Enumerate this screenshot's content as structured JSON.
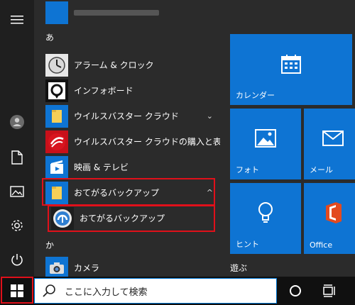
{
  "app_list": {
    "top_item_blurred": "",
    "groups": [
      {
        "letter": "あ",
        "items": [
          {
            "label": "アラーム & クロック",
            "icon": "alarm-clock-icon"
          },
          {
            "label": "インフォボード",
            "icon": "infoboard-icon"
          },
          {
            "label": "ウイルスバスター クラウド",
            "icon": "folder-icon",
            "expandable": true,
            "chevron": "⌄"
          },
          {
            "label": "ウイルスバスター クラウドの購入と表示",
            "icon": "trend-micro-icon"
          },
          {
            "label": "映画 & テレビ",
            "icon": "movies-tv-icon"
          },
          {
            "label": "おてがるバックアップ",
            "icon": "folder-icon",
            "expandable": true,
            "chevron": "^"
          },
          {
            "label": "おてがるバックアップ",
            "icon": "backup-app-icon",
            "sub": true
          }
        ]
      },
      {
        "letter": "か",
        "items": [
          {
            "label": "カメラ",
            "icon": "camera-icon"
          }
        ]
      }
    ]
  },
  "tiles": {
    "calendar": "カレンダー",
    "photos": "フォト",
    "mail": "メール",
    "tips": "ヒント",
    "office": "Office",
    "section_play": "遊ぶ"
  },
  "taskbar": {
    "search_placeholder": "ここに入力して検索"
  },
  "colors": {
    "accent": "#0e74d3",
    "highlight": "#e0101a"
  }
}
